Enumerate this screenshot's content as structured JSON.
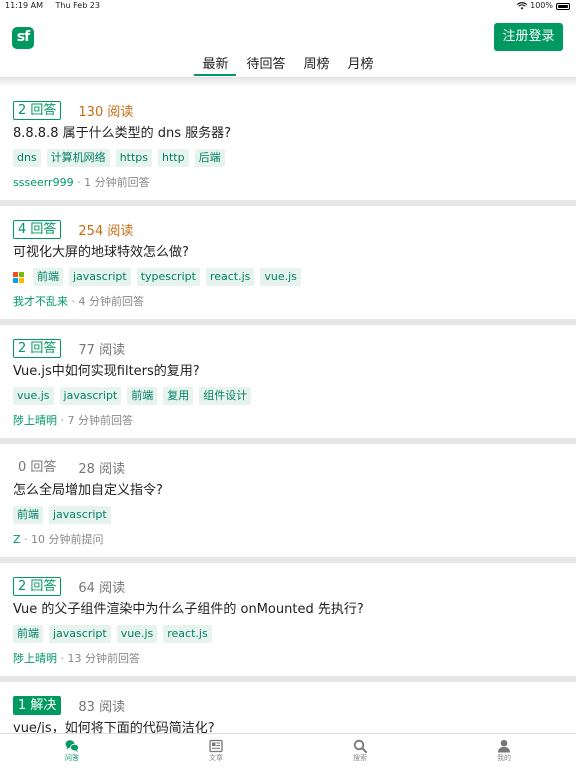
{
  "status_bar": {
    "time": "11:19 AM",
    "date": "Thu Feb 23",
    "battery": "100%"
  },
  "header": {
    "logo_text": "sf",
    "register_label": "注册登录",
    "tabs": [
      {
        "label": "最新",
        "active": true
      },
      {
        "label": "待回答",
        "active": false
      },
      {
        "label": "周榜",
        "active": false
      },
      {
        "label": "月榜",
        "active": false
      }
    ]
  },
  "questions": [
    {
      "answers": "2 回答",
      "answer_state": "answered",
      "views": "130 阅读",
      "views_hot": true,
      "title": "8.8.8.8 属于什么类型的 dns 服务器?",
      "tags": [
        "dns",
        "计算机网络",
        "https",
        "http",
        "后端"
      ],
      "user": "ssseerr999",
      "time": " · 1 分钟前回答"
    },
    {
      "answers": "4 回答",
      "answer_state": "answered",
      "views": "254 阅读",
      "views_hot": true,
      "title": "可视化大屏的地球特效怎么做?",
      "tag_icon": "windows-logo-icon",
      "tags": [
        "前端",
        "javascript",
        "typescript",
        "react.js",
        "vue.js"
      ],
      "user": "我才不乱来",
      "time": " · 4 分钟前回答"
    },
    {
      "answers": "2 回答",
      "answer_state": "answered",
      "views": "77 阅读",
      "views_hot": false,
      "title": "Vue.js中如何实现filters的复用?",
      "tags": [
        "vue.js",
        "javascript",
        "前端",
        "复用",
        "组件设计"
      ],
      "user": "陟上晴明",
      "time": " · 7 分钟前回答"
    },
    {
      "answers": "0 回答",
      "answer_state": "none",
      "views": "28 阅读",
      "views_hot": false,
      "title": "怎么全局增加自定义指令?",
      "tags": [
        "前端",
        "javascript"
      ],
      "user": "Z",
      "time": " · 10 分钟前提问"
    },
    {
      "answers": "2 回答",
      "answer_state": "answered",
      "views": "64 阅读",
      "views_hot": false,
      "title": "Vue 的父子组件渲染中为什么子组件的 onMounted 先执行?",
      "tags": [
        "前端",
        "javascript",
        "vue.js",
        "react.js"
      ],
      "user": "陟上晴明",
      "time": " · 13 分钟前回答"
    },
    {
      "answers": "1 解决",
      "answer_state": "solved",
      "views": "83 阅读",
      "views_hot": false,
      "title": "vue/js，如何将下面的代码简洁化?",
      "tags": [],
      "user": "",
      "time": ""
    }
  ],
  "bottom_nav": [
    {
      "label": "问答",
      "icon": "qa-bubbles-icon",
      "active": true
    },
    {
      "label": "文章",
      "icon": "article-icon",
      "active": false
    },
    {
      "label": "搜索",
      "icon": "search-icon",
      "active": false
    },
    {
      "label": "我的",
      "icon": "user-icon",
      "active": false
    }
  ],
  "colors": {
    "brand": "#009a61",
    "hot_views": "#c76b12",
    "tag_bg": "#e7f4ee",
    "tag_text": "#017e66"
  }
}
